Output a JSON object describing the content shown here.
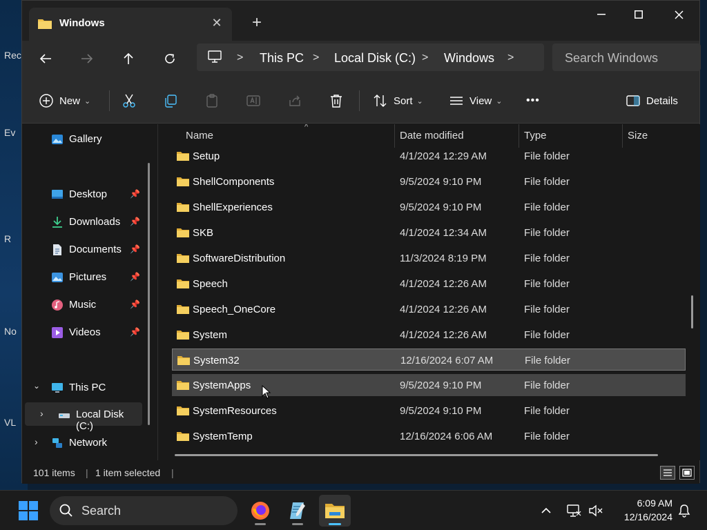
{
  "desktop": {
    "icons": [
      "Rec",
      "Ev",
      "R",
      "No",
      "VL"
    ]
  },
  "window": {
    "tab_title": "Windows",
    "new_tab_symbol": "+"
  },
  "address": {
    "crumbs": [
      "This PC",
      "Local Disk (C:)",
      "Windows"
    ],
    "search_placeholder": "Search Windows"
  },
  "commands": {
    "new_label": "New",
    "sort_label": "Sort",
    "view_label": "View",
    "more_label": "•••",
    "details_label": "Details"
  },
  "sidebar": {
    "items": [
      {
        "label": "Gallery",
        "icon": "gallery-icon"
      },
      {
        "label": "Desktop",
        "icon": "desktop-icon",
        "pinned": true
      },
      {
        "label": "Downloads",
        "icon": "downloads-icon",
        "pinned": true
      },
      {
        "label": "Documents",
        "icon": "documents-icon",
        "pinned": true
      },
      {
        "label": "Pictures",
        "icon": "pictures-icon",
        "pinned": true
      },
      {
        "label": "Music",
        "icon": "music-icon",
        "pinned": true
      },
      {
        "label": "Videos",
        "icon": "videos-icon",
        "pinned": true
      },
      {
        "label": "This PC",
        "icon": "this-pc-icon"
      },
      {
        "label": "Local Disk (C:)",
        "icon": "drive-icon"
      },
      {
        "label": "Network",
        "icon": "network-icon"
      }
    ]
  },
  "columns": {
    "name": "Name",
    "date": "Date modified",
    "type": "Type",
    "size": "Size"
  },
  "files": [
    {
      "name": "Setup",
      "date": "4/1/2024 12:29 AM",
      "type": "File folder"
    },
    {
      "name": "ShellComponents",
      "date": "9/5/2024 9:10 PM",
      "type": "File folder"
    },
    {
      "name": "ShellExperiences",
      "date": "9/5/2024 9:10 PM",
      "type": "File folder"
    },
    {
      "name": "SKB",
      "date": "4/1/2024 12:34 AM",
      "type": "File folder"
    },
    {
      "name": "SoftwareDistribution",
      "date": "11/3/2024 8:19 PM",
      "type": "File folder"
    },
    {
      "name": "Speech",
      "date": "4/1/2024 12:26 AM",
      "type": "File folder"
    },
    {
      "name": "Speech_OneCore",
      "date": "4/1/2024 12:26 AM",
      "type": "File folder"
    },
    {
      "name": "System",
      "date": "4/1/2024 12:26 AM",
      "type": "File folder"
    },
    {
      "name": "System32",
      "date": "12/16/2024 6:07 AM",
      "type": "File folder",
      "selected": true
    },
    {
      "name": "SystemApps",
      "date": "9/5/2024 9:10 PM",
      "type": "File folder",
      "hovered": true
    },
    {
      "name": "SystemResources",
      "date": "9/5/2024 9:10 PM",
      "type": "File folder"
    },
    {
      "name": "SystemTemp",
      "date": "12/16/2024 6:06 AM",
      "type": "File folder"
    }
  ],
  "status": {
    "item_count": "101 items",
    "selection": "1 item selected"
  },
  "taskbar": {
    "search_label": "Search",
    "time": "6:09 AM",
    "date": "12/16/2024"
  },
  "colors": {
    "accent": "#4cc2ff",
    "folder": "#f0c24b",
    "selected_row": "#4d4d4d"
  }
}
